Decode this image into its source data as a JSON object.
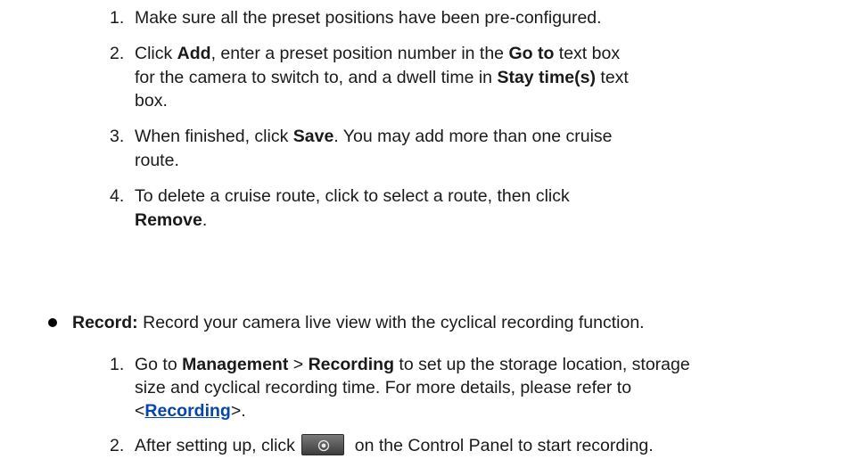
{
  "list1": {
    "items": [
      {
        "num": "1.",
        "lines": [
          {
            "parts": [
              "Make sure all the preset positions have been pre-configured."
            ]
          }
        ]
      },
      {
        "num": "2.",
        "lines": [
          {
            "parts": [
              "Click ",
              "Add",
              ", enter a preset position number in the ",
              "Go to",
              " text box"
            ]
          },
          {
            "parts": [
              "for the camera to switch to, and a dwell time in ",
              "Stay time(s)",
              " text"
            ]
          },
          {
            "parts": [
              "box."
            ]
          }
        ]
      },
      {
        "num": "3.",
        "lines": [
          {
            "parts": [
              "When finished, click ",
              "Save",
              ". You may add more than one cruise"
            ]
          },
          {
            "parts": [
              "route."
            ]
          }
        ]
      },
      {
        "num": "4.",
        "lines": [
          {
            "parts": [
              "To delete a cruise route, click to select a route, then click"
            ]
          },
          {
            "parts": [
              "Remove",
              "."
            ]
          }
        ]
      }
    ]
  },
  "record": {
    "label": "Record:",
    "text": " Record your camera live view with the cyclical recording function."
  },
  "list2": {
    "item1": {
      "num": "1.",
      "line1": [
        "Go to ",
        "Management",
        " > ",
        "Recording",
        " to set up the storage location, storage"
      ],
      "line2": [
        "size and cyclical recording time. For more details, please refer to"
      ],
      "line3": [
        "<",
        "Recording",
        ">."
      ]
    },
    "item2": {
      "num": "2.",
      "before": "After setting up, click ",
      "button_icon": "record-icon",
      "after": " on the Control Panel to start recording."
    }
  }
}
